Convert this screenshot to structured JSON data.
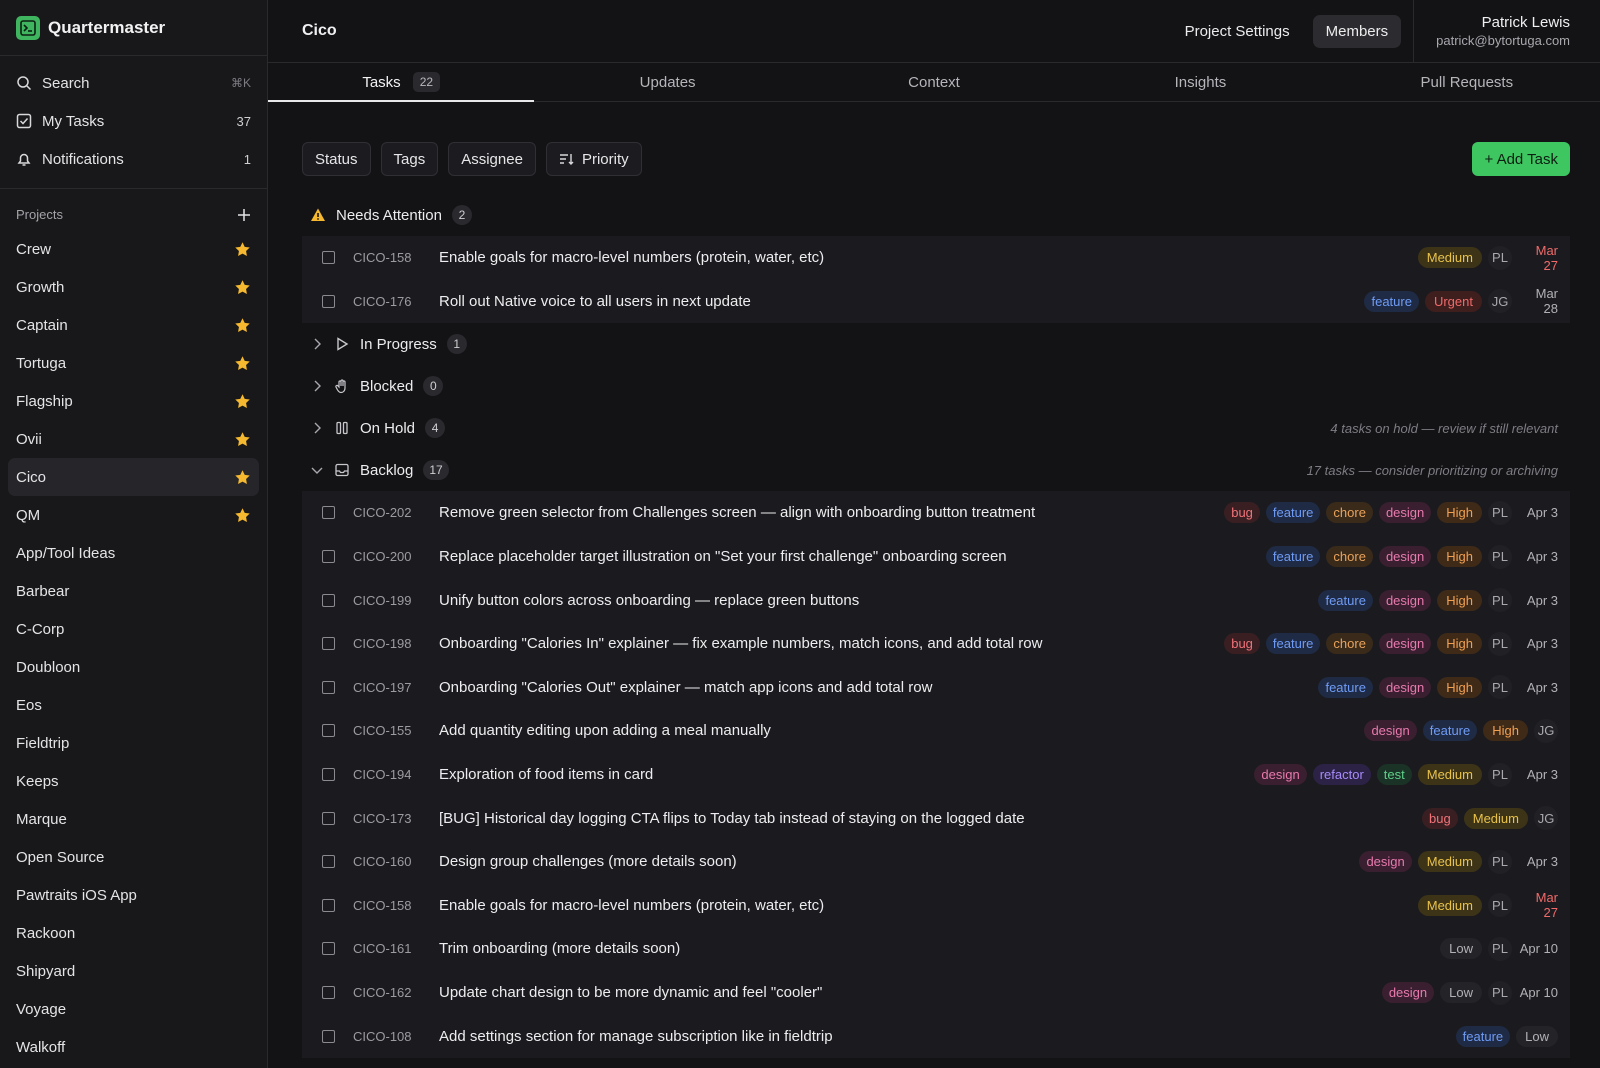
{
  "app": {
    "name": "Quartermaster"
  },
  "nav": {
    "search": {
      "label": "Search",
      "shortcut": "⌘K"
    },
    "my_tasks": {
      "label": "My Tasks",
      "count": "37"
    },
    "notifications": {
      "label": "Notifications",
      "count": "1"
    }
  },
  "projects": {
    "header": "Projects",
    "items": [
      {
        "name": "Crew",
        "starred": true
      },
      {
        "name": "Growth",
        "starred": true
      },
      {
        "name": "Captain",
        "starred": true
      },
      {
        "name": "Tortuga",
        "starred": true
      },
      {
        "name": "Flagship",
        "starred": true
      },
      {
        "name": "Ovii",
        "starred": true
      },
      {
        "name": "Cico",
        "starred": true,
        "active": true
      },
      {
        "name": "QM",
        "starred": true
      },
      {
        "name": "App/Tool Ideas"
      },
      {
        "name": "Barbear"
      },
      {
        "name": "C-Corp"
      },
      {
        "name": "Doubloon"
      },
      {
        "name": "Eos"
      },
      {
        "name": "Fieldtrip"
      },
      {
        "name": "Keeps"
      },
      {
        "name": "Marque"
      },
      {
        "name": "Open Source"
      },
      {
        "name": "Pawtraits iOS App"
      },
      {
        "name": "Rackoon"
      },
      {
        "name": "Shipyard"
      },
      {
        "name": "Voyage"
      },
      {
        "name": "Walkoff"
      }
    ]
  },
  "header": {
    "project_title": "Cico",
    "settings_label": "Project Settings",
    "members_label": "Members",
    "user_name": "Patrick Lewis",
    "user_email": "patrick@bytortuga.com"
  },
  "tabs": [
    {
      "label": "Tasks",
      "count": "22",
      "active": true
    },
    {
      "label": "Updates"
    },
    {
      "label": "Context"
    },
    {
      "label": "Insights"
    },
    {
      "label": "Pull Requests"
    }
  ],
  "filters": {
    "status": "Status",
    "tags": "Tags",
    "assignee": "Assignee",
    "priority": "Priority",
    "add_task": "+ Add Task"
  },
  "colors": {
    "accent": "#3ec760",
    "star": "#f5b82e"
  },
  "groups": {
    "needs_attention": {
      "name": "Needs Attention",
      "count": "2",
      "tasks": [
        {
          "id": "CICO-158",
          "title": "Enable goals for macro-level numbers (protein, water, etc)",
          "tags": [],
          "priority": "Medium",
          "assignee": "PL",
          "date": "Mar 27",
          "overdue": true
        },
        {
          "id": "CICO-176",
          "title": "Roll out Native voice to all users in next update",
          "tags": [
            "feature"
          ],
          "priority": "Urgent",
          "assignee": "JG",
          "date": "Mar 28",
          "overdue": false
        }
      ]
    },
    "in_progress": {
      "name": "In Progress",
      "count": "1"
    },
    "blocked": {
      "name": "Blocked",
      "count": "0"
    },
    "on_hold": {
      "name": "On Hold",
      "count": "4",
      "note": "4 tasks on hold — review if still relevant"
    },
    "backlog": {
      "name": "Backlog",
      "count": "17",
      "note": "17 tasks — consider prioritizing or archiving",
      "tasks": [
        {
          "id": "CICO-202",
          "title": "Remove green selector from Challenges screen — align with onboarding button treatment",
          "tags": [
            "bug",
            "feature",
            "chore",
            "design"
          ],
          "priority": "High",
          "assignee": "PL",
          "date": "Apr 3"
        },
        {
          "id": "CICO-200",
          "title": "Replace placeholder target illustration on \"Set your first challenge\" onboarding screen",
          "tags": [
            "feature",
            "chore",
            "design"
          ],
          "priority": "High",
          "assignee": "PL",
          "date": "Apr 3"
        },
        {
          "id": "CICO-199",
          "title": "Unify button colors across onboarding — replace green buttons",
          "tags": [
            "feature",
            "design"
          ],
          "priority": "High",
          "assignee": "PL",
          "date": "Apr 3"
        },
        {
          "id": "CICO-198",
          "title": "Onboarding \"Calories In\" explainer — fix example numbers, match icons, and add total row",
          "tags": [
            "bug",
            "feature",
            "chore",
            "design"
          ],
          "priority": "High",
          "assignee": "PL",
          "date": "Apr 3"
        },
        {
          "id": "CICO-197",
          "title": "Onboarding \"Calories Out\" explainer — match app icons and add total row",
          "tags": [
            "feature",
            "design"
          ],
          "priority": "High",
          "assignee": "PL",
          "date": "Apr 3"
        },
        {
          "id": "CICO-155",
          "title": "Add quantity editing upon adding a meal manually",
          "tags": [
            "design",
            "feature"
          ],
          "priority": "High",
          "assignee": "JG",
          "date": ""
        },
        {
          "id": "CICO-194",
          "title": "Exploration of food items in card",
          "tags": [
            "design",
            "refactor",
            "test"
          ],
          "priority": "Medium",
          "assignee": "PL",
          "date": "Apr 3"
        },
        {
          "id": "CICO-173",
          "title": "[BUG] Historical day logging CTA flips to Today tab instead of staying on the logged date",
          "tags": [
            "bug"
          ],
          "priority": "Medium",
          "assignee": "JG",
          "date": ""
        },
        {
          "id": "CICO-160",
          "title": "Design group challenges (more details soon)",
          "tags": [
            "design"
          ],
          "priority": "Medium",
          "assignee": "PL",
          "date": "Apr 3"
        },
        {
          "id": "CICO-158",
          "title": "Enable goals for macro-level numbers (protein, water, etc)",
          "tags": [],
          "priority": "Medium",
          "assignee": "PL",
          "date": "Mar 27",
          "overdue": true
        },
        {
          "id": "CICO-161",
          "title": "Trim onboarding (more details soon)",
          "tags": [],
          "priority": "Low",
          "assignee": "PL",
          "date": "Apr 10"
        },
        {
          "id": "CICO-162",
          "title": "Update chart design to be more dynamic and feel \"cooler\"",
          "tags": [
            "design"
          ],
          "priority": "Low",
          "assignee": "PL",
          "date": "Apr 10"
        },
        {
          "id": "CICO-108",
          "title": "Add settings section for manage subscription like in fieldtrip",
          "tags": [
            "feature"
          ],
          "priority": "Low",
          "assignee": "",
          "date": ""
        }
      ]
    }
  }
}
